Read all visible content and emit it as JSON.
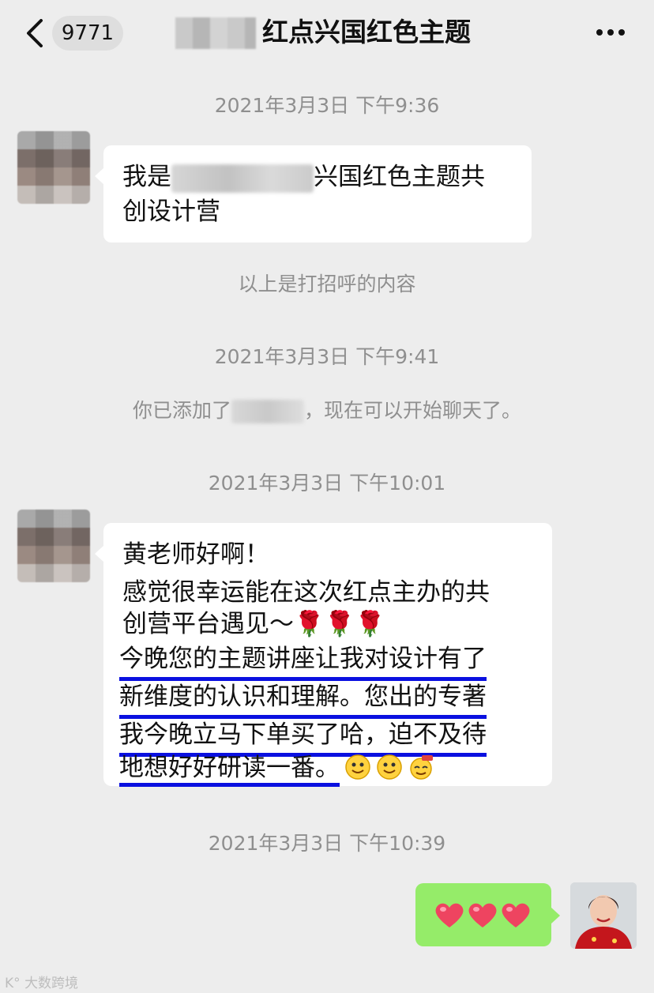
{
  "header": {
    "unread_count": "9771",
    "title": "红点兴国红色主题"
  },
  "messages": {
    "time1": "2021年3月3日 下午9:36",
    "greet_prefix": "我是",
    "greet_suffix": "兴国红色主题共",
    "greet_line2": "创设计营",
    "greet_note": "以上是打招呼的内容",
    "time2": "2021年3月3日 下午9:41",
    "added_prefix": "你已添加了",
    "added_suffix": "，现在可以开始聊天了。",
    "time3": "2021年3月3日 下午10:01",
    "msg_line1": "黄老师好啊！",
    "msg_line2": "感觉很幸运能在这次红点主办的共",
    "msg_line3": "创营平台遇见～🌹🌹🌹",
    "msg_line4": "今晚您的主题讲座让我对设计有了",
    "msg_line5": "新维度的认识和理解。您出的专著",
    "msg_line6": "我今晚立马下单买了哈，迫不及待",
    "msg_line7": "地想好好研读一番。",
    "time4": "2021年3月3日 下午10:39",
    "reply_hearts": "❤❤❤"
  },
  "watermark": "大数跨境",
  "colors": {
    "background": "#ededed",
    "bubble_received": "#ffffff",
    "bubble_sent": "#95ec69",
    "underline": "#0a10e0"
  }
}
